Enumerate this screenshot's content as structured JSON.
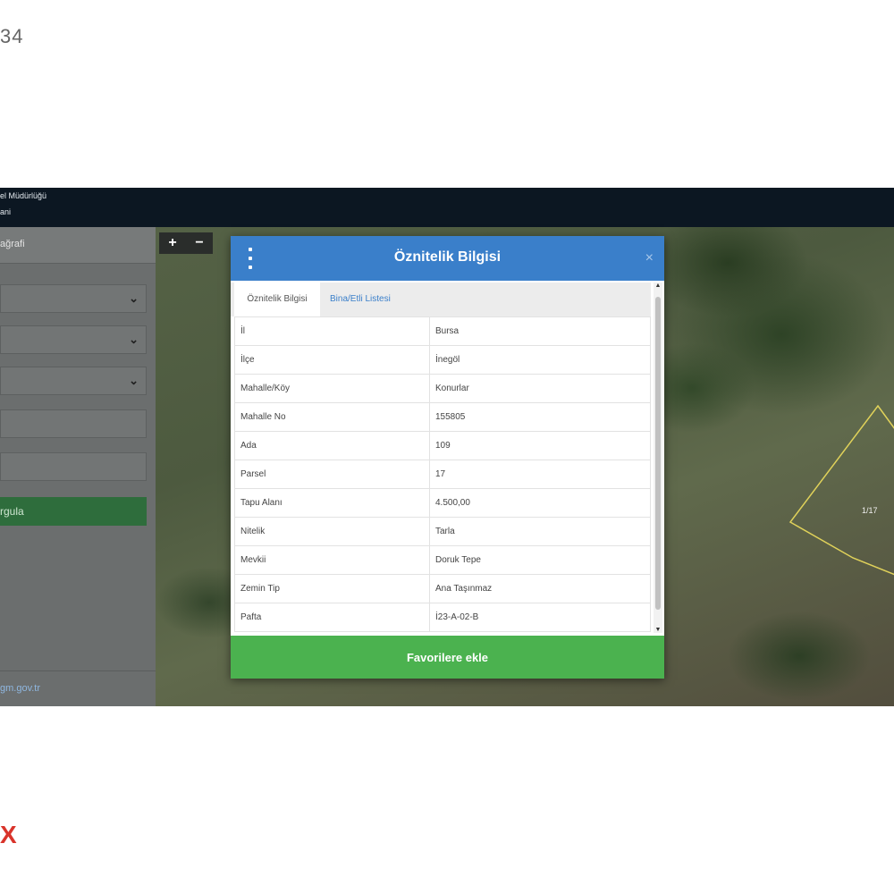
{
  "page": {
    "corner_number": "34",
    "corner_mark": "X"
  },
  "topbar": {
    "line1": "el Müdürlüğü",
    "line2": "ani"
  },
  "sidebar": {
    "header_label": "ağrafi",
    "search_button_label": "rgula",
    "footer_link": "gm.gov.tr"
  },
  "map": {
    "zoom_in": "+",
    "zoom_out": "−",
    "parcel_label": "1/17"
  },
  "modal": {
    "title": "Öznitelik Bilgisi",
    "close": "×",
    "tabs": [
      {
        "label": "Öznitelik Bilgisi",
        "active": true
      },
      {
        "label": "Bina/Etli Listesi",
        "active": false
      }
    ],
    "rows": [
      {
        "key": "İl",
        "value": "Bursa"
      },
      {
        "key": "İlçe",
        "value": "İnegöl"
      },
      {
        "key": "Mahalle/Köy",
        "value": "Konurlar"
      },
      {
        "key": "Mahalle No",
        "value": "155805"
      },
      {
        "key": "Ada",
        "value": "109"
      },
      {
        "key": "Parsel",
        "value": "17"
      },
      {
        "key": "Tapu Alanı",
        "value": "4.500,00"
      },
      {
        "key": "Nitelik",
        "value": "Tarla"
      },
      {
        "key": "Mevkii",
        "value": "Doruk Tepe"
      },
      {
        "key": "Zemin Tip",
        "value": "Ana Taşınmaz"
      },
      {
        "key": "Pafta",
        "value": "İ23-A-02-B"
      }
    ],
    "favorite_button": "Favorilere ekle"
  },
  "colors": {
    "header_blue": "#3a7fca",
    "favorite_green": "#4bb24f",
    "sidebar_green": "#2e6d3c",
    "parcel_outline": "#e0d25a"
  }
}
